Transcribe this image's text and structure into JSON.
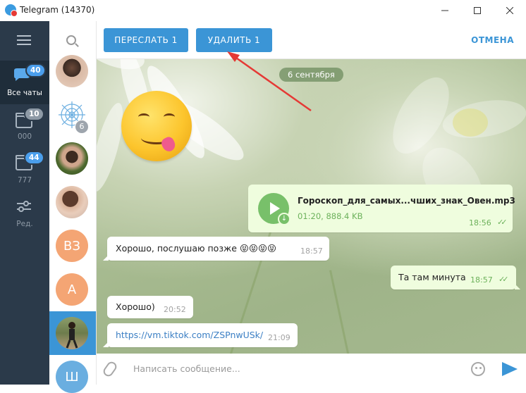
{
  "window": {
    "title": "Telegram (14370)",
    "minimize_icon": "minimize-icon",
    "maximize_icon": "maximize-icon",
    "close_icon": "close-icon"
  },
  "nav": {
    "items": [
      {
        "label": "Все чаты",
        "badge": "40",
        "icon": "chats-icon",
        "active": true
      },
      {
        "label": "000",
        "badge": "10",
        "icon": "folder-icon",
        "active": false
      },
      {
        "label": "777",
        "badge": "44",
        "icon": "folder-icon",
        "active": false
      },
      {
        "label": "Ред.",
        "badge": "",
        "icon": "sliders-icon",
        "active": false
      }
    ]
  },
  "chatlist": {
    "avatars": [
      {
        "type": "photo",
        "color": "#c9a27e"
      },
      {
        "type": "pattern",
        "color": "#9ccbe8",
        "badge": "6"
      },
      {
        "type": "photo",
        "color": "#5f7a3e"
      },
      {
        "type": "photo",
        "color": "#b98a72"
      },
      {
        "type": "letter",
        "text": "ВЗ",
        "color": "#f4a574"
      },
      {
        "type": "letter",
        "text": "А",
        "color": "#f4a574"
      },
      {
        "type": "photo",
        "color": "#7c8a5a",
        "active": true
      },
      {
        "type": "letter",
        "text": "Ш",
        "color": "#6aaee0"
      }
    ]
  },
  "topbar": {
    "forward_label": "ПЕРЕСЛАТЬ  1",
    "delete_label": "УДАЛИТЬ  1",
    "cancel_label": "ОТМЕНА"
  },
  "messages": {
    "date": "6 сентября",
    "audio": {
      "filename": "Гороскоп_для_самых...чших_знак_Овен.mp3",
      "meta": "01:20, 888.4 KB",
      "time": "18:56"
    },
    "m1": {
      "text": "Хорошо, послушаю позже 😝😝😝😝",
      "time": "18:57"
    },
    "m2": {
      "text": "Та там минута",
      "time": "18:57"
    },
    "m3": {
      "text": "Хорошо)",
      "time": "20:52"
    },
    "m4": {
      "text": "https://vm.tiktok.com/ZSPnwUSk/",
      "time": "21:09"
    }
  },
  "input": {
    "placeholder": "Написать сообщение..."
  },
  "colors": {
    "accent": "#3b95d6",
    "nav_bg": "#2b3a4a",
    "outgoing_bubble": "#effdde",
    "annotation_arrow": "#e53935"
  }
}
